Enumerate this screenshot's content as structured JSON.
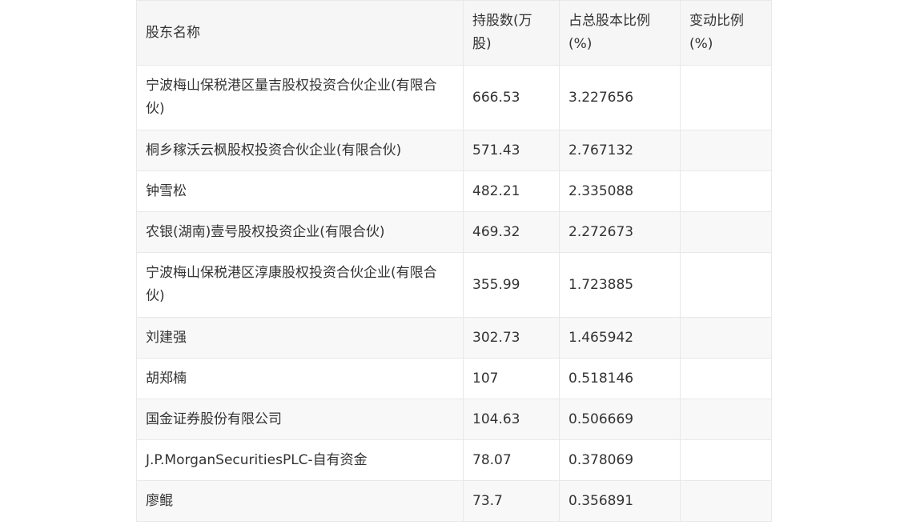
{
  "table": {
    "headers": [
      "股东名称",
      "持股数(万股)",
      "占总股本比例(%)",
      "变动比例(%)"
    ],
    "rows": [
      {
        "name": "宁波梅山保税港区量吉股权投资合伙企业(有限合伙)",
        "shares": "666.53",
        "ratio": "3.227656",
        "change": ""
      },
      {
        "name": "桐乡稼沃云枫股权投资合伙企业(有限合伙)",
        "shares": "571.43",
        "ratio": "2.767132",
        "change": ""
      },
      {
        "name": "钟雪松",
        "shares": "482.21",
        "ratio": "2.335088",
        "change": ""
      },
      {
        "name": "农银(湖南)壹号股权投资企业(有限合伙)",
        "shares": "469.32",
        "ratio": "2.272673",
        "change": ""
      },
      {
        "name": "宁波梅山保税港区淳康股权投资合伙企业(有限合伙)",
        "shares": "355.99",
        "ratio": "1.723885",
        "change": ""
      },
      {
        "name": "刘建强",
        "shares": "302.73",
        "ratio": "1.465942",
        "change": ""
      },
      {
        "name": "胡郑楠",
        "shares": "107",
        "ratio": "0.518146",
        "change": ""
      },
      {
        "name": "国金证券股份有限公司",
        "shares": "104.63",
        "ratio": "0.506669",
        "change": ""
      },
      {
        "name": "J.P.MorganSecuritiesPLC-自有资金",
        "shares": "78.07",
        "ratio": "0.378069",
        "change": ""
      },
      {
        "name": "廖鲲",
        "shares": "73.7",
        "ratio": "0.356891",
        "change": ""
      }
    ]
  }
}
